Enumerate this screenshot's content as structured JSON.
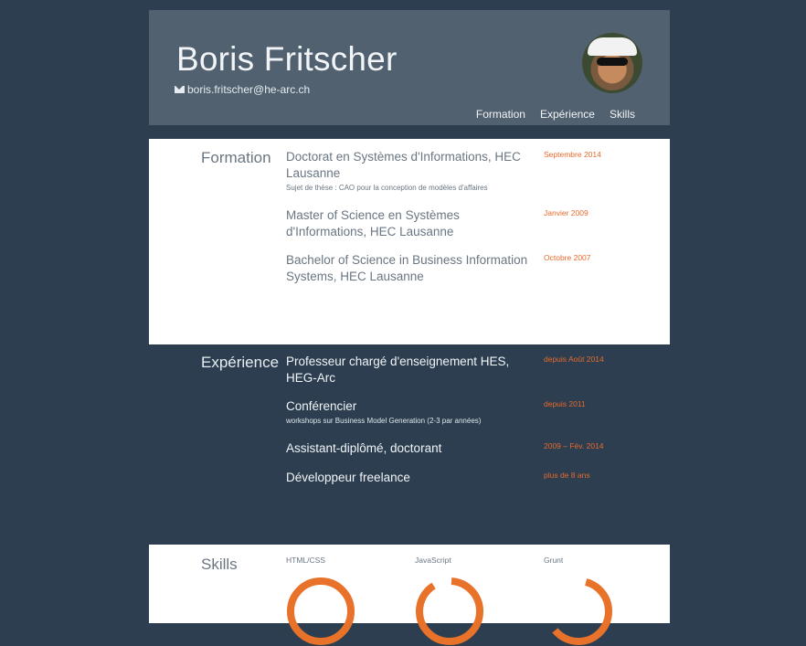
{
  "header": {
    "name": "Boris Fritscher",
    "email": "boris.fritscher@he-arc.ch",
    "nav": [
      "Formation",
      "Expérience",
      "Skills"
    ]
  },
  "formation": {
    "title": "Formation",
    "items": [
      {
        "title": "Doctorat en Systèmes d'Informations, HEC Lausanne",
        "subtitle": "Sujet de thèse : CAO pour la conception de modèles d'affaires",
        "date": "Septembre 2014"
      },
      {
        "title": "Master of Science en Systèmes d'Informations, HEC Lausanne",
        "subtitle": "",
        "date": "Janvier 2009"
      },
      {
        "title": "Bachelor of Science in Business Information Systems, HEC Lausanne",
        "subtitle": "",
        "date": "Octobre 2007"
      }
    ]
  },
  "experience": {
    "title": "Expérience",
    "items": [
      {
        "title": "Professeur chargé d'enseignement HES, HEG-Arc",
        "subtitle": "",
        "date": "depuis Août 2014"
      },
      {
        "title": "Conférencier",
        "subtitle": "workshops sur Business Model Generation (2-3 par années)",
        "date": "depuis 2011"
      },
      {
        "title": "Assistant-diplômé, doctorant",
        "subtitle": "",
        "date": "2009 – Fév. 2014"
      },
      {
        "title": "Développeur freelance",
        "subtitle": "",
        "date": "plus de 8 ans"
      }
    ]
  },
  "skills": {
    "title": "Skills",
    "items": [
      {
        "label": "HTML/CSS",
        "level": 1.0
      },
      {
        "label": "JavaScript",
        "level": 0.9
      },
      {
        "label": "Grunt",
        "level": 0.6
      }
    ],
    "accent": "#e8722a"
  }
}
